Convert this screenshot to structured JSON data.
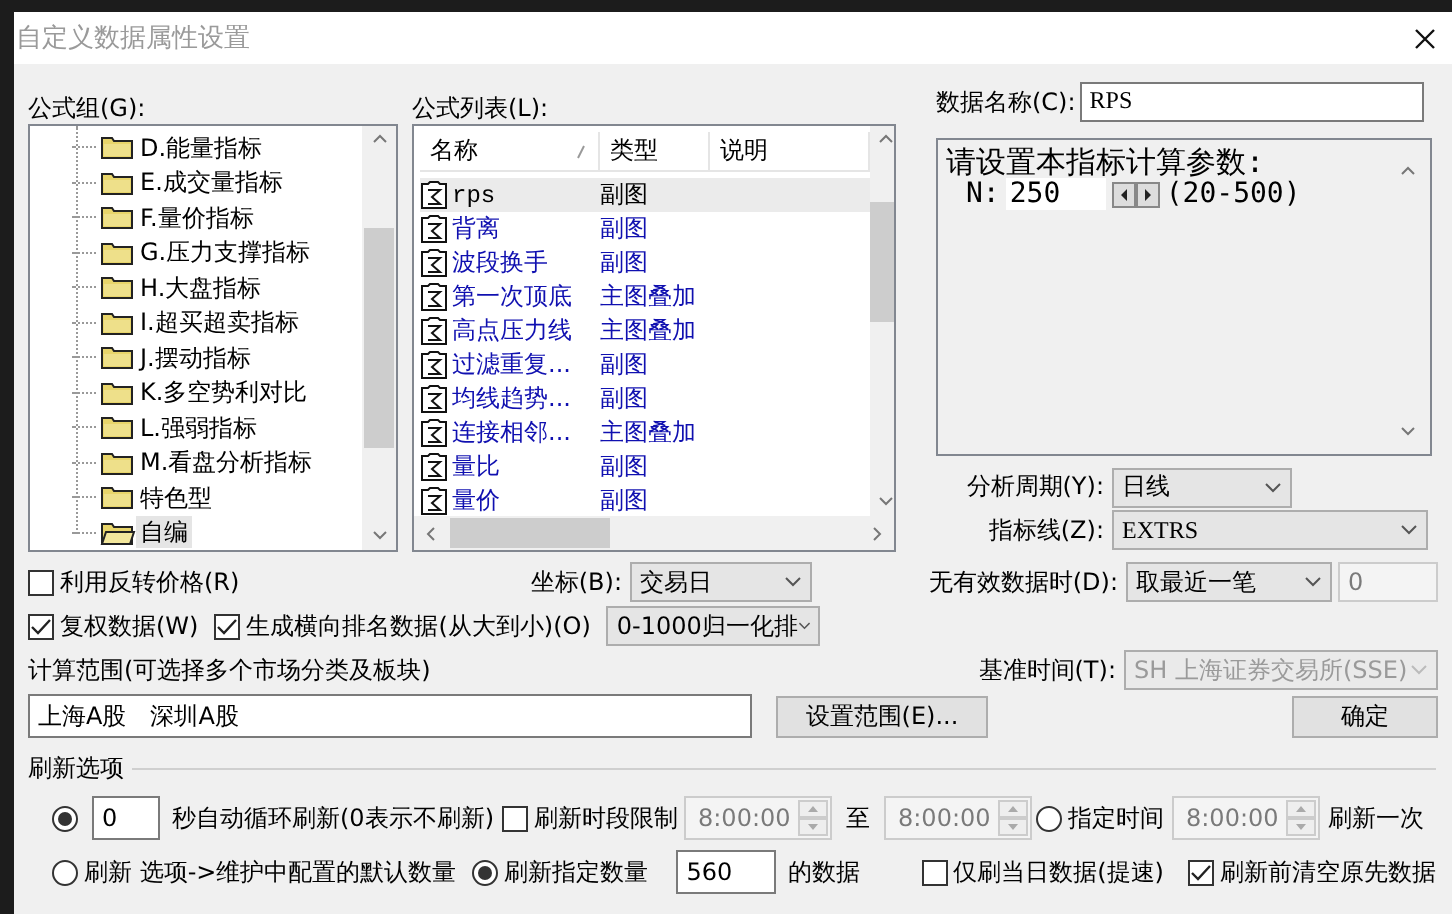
{
  "dialog": {
    "title": "自定义数据属性设置"
  },
  "formula_group": {
    "label": "公式组(G):",
    "items": [
      {
        "label": "D.能量指标",
        "selected": false
      },
      {
        "label": "E.成交量指标",
        "selected": false
      },
      {
        "label": "F.量价指标",
        "selected": false
      },
      {
        "label": "G.压力支撑指标",
        "selected": false
      },
      {
        "label": "H.大盘指标",
        "selected": false
      },
      {
        "label": "I.超买超卖指标",
        "selected": false
      },
      {
        "label": "J.摆动指标",
        "selected": false
      },
      {
        "label": "K.多空势利对比",
        "selected": false
      },
      {
        "label": "L.强弱指标",
        "selected": false
      },
      {
        "label": "M.看盘分析指标",
        "selected": false
      },
      {
        "label": "特色型",
        "selected": false
      },
      {
        "label": "自编",
        "selected": true
      }
    ]
  },
  "formula_list": {
    "label": "公式列表(L):",
    "columns": [
      "名称",
      "类型",
      "说明"
    ],
    "rows": [
      {
        "name": "rps",
        "type": "副图",
        "selected": true
      },
      {
        "name": "背离",
        "type": "副图",
        "selected": false
      },
      {
        "name": "波段换手",
        "type": "副图",
        "selected": false
      },
      {
        "name": "第一次顶底",
        "type": "主图叠加",
        "selected": false
      },
      {
        "name": "高点压力线",
        "type": "主图叠加",
        "selected": false
      },
      {
        "name": "过滤重复...",
        "type": "副图",
        "selected": false
      },
      {
        "name": "均线趋势...",
        "type": "副图",
        "selected": false
      },
      {
        "name": "连接相邻...",
        "type": "主图叠加",
        "selected": false
      },
      {
        "name": "量比",
        "type": "副图",
        "selected": false
      },
      {
        "name": "量价",
        "type": "副图",
        "selected": false
      }
    ]
  },
  "data_name": {
    "label": "数据名称(C):",
    "value": "RPS"
  },
  "params": {
    "title": "请设置本指标计算参数:",
    "rows": [
      {
        "name": "N:",
        "value": "250",
        "range": "(20-500)"
      }
    ]
  },
  "analysis_period": {
    "label": "分析周期(Y):",
    "value": "日线"
  },
  "indicator_line": {
    "label": "指标线(Z):",
    "value": "EXTRS"
  },
  "reverse_price": {
    "label": "利用反转价格(R)",
    "checked": false
  },
  "coordinate": {
    "label": "坐标(B):",
    "value": "交易日"
  },
  "no_valid_data": {
    "label": "无有效数据时(D):",
    "value": "取最近一笔",
    "extra": {
      "value": "0",
      "disabled": true
    }
  },
  "adjusted": {
    "label": "复权数据(W)",
    "checked": true
  },
  "ranking": {
    "label": "生成横向排名数据(从大到小)(O)",
    "checked": true,
    "mode": "0-1000归一化排"
  },
  "range": {
    "label": "计算范围(可选择多个市场分类及板块)",
    "value": "上海A股　深圳A股",
    "button": "设置范围(E)..."
  },
  "base_time": {
    "label": "基准时间(T):",
    "value": "SH 上海证券交易所(SSE)",
    "disabled": true
  },
  "ok_button": "确定",
  "refresh": {
    "title": "刷新选项",
    "auto": {
      "selected": true,
      "value": "0",
      "label": "秒自动循环刷新(0表示不刷新)"
    },
    "period_limit": {
      "label": "刷新时段限制",
      "checked": false,
      "from": "8:00:00",
      "to_label": "至",
      "to": "8:00:00"
    },
    "fixed_time": {
      "label": "指定时间",
      "selected": false,
      "value": "8:00:00",
      "suffix": "刷新一次"
    },
    "default_count": {
      "label": "刷新 选项->维护中配置的默认数量",
      "selected": false
    },
    "fixed_count": {
      "label": "刷新指定数量",
      "selected": true,
      "value": "560",
      "suffix": "的数据"
    },
    "today_only": {
      "label": "仅刷当日数据(提速)",
      "checked": false
    },
    "clear_first": {
      "label": "刷新前清空原先数据",
      "checked": true
    }
  }
}
